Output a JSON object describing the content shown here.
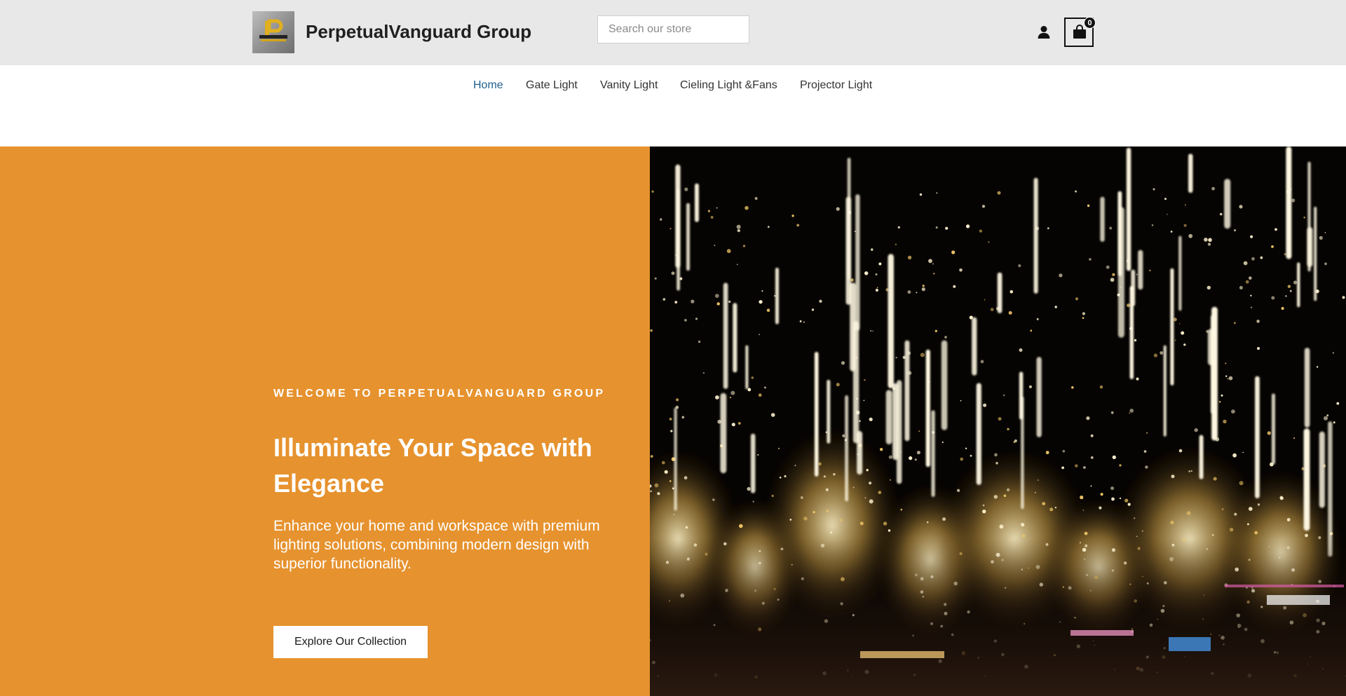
{
  "header": {
    "logo_alt": "PerpetualVanguard logo",
    "store_name": "PerpetualVanguard Group",
    "search_placeholder": "Search our store",
    "account_icon": "user-icon",
    "cart_icon": "shopping-bag-icon",
    "cart_count": "0"
  },
  "nav": {
    "items": [
      {
        "label": "Home",
        "active": true
      },
      {
        "label": "Gate Light",
        "active": false
      },
      {
        "label": "Vanity Light",
        "active": false
      },
      {
        "label": "Cieling Light &Fans",
        "active": false
      },
      {
        "label": "Projector Light",
        "active": false
      }
    ]
  },
  "hero": {
    "eyebrow": "WELCOME TO PERPETUALVANGUARD GROUP",
    "headline": "Illuminate Your Space with Elegance",
    "subtext": "Enhance your home and workspace with premium lighting solutions, combining modern design with superior functionality.",
    "cta_label": "Explore Our Collection",
    "image_alt": "Meteor shower string lights hanging over illuminated trees at night"
  },
  "colors": {
    "header_bg": "#e8e8e8",
    "hero_bg": "#e6922e",
    "nav_active": "#1f5f8b",
    "light_glow": "#fff5d6"
  }
}
